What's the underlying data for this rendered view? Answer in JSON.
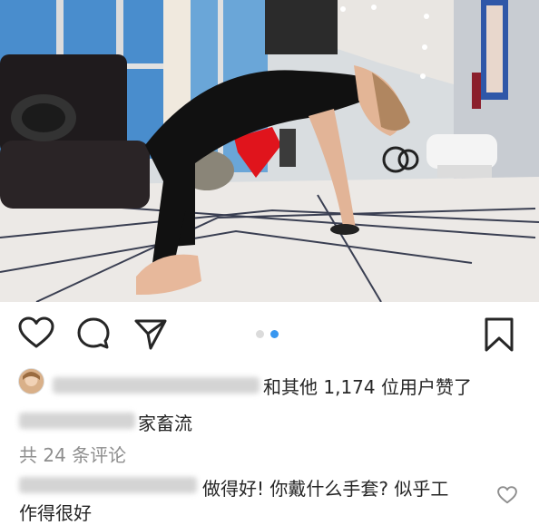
{
  "post": {
    "photo": {
      "alt": "yoga-backbend-photo",
      "carousel_index": 2,
      "carousel_total": 2
    },
    "actions": {
      "like_icon": "heart-outline-icon",
      "comment_icon": "comment-bubble-icon",
      "share_icon": "paper-plane-icon",
      "save_icon": "bookmark-outline-icon"
    },
    "colors": {
      "text": "#262626",
      "muted": "#8e8e8e",
      "dot_active": "#3897f0",
      "dot_inactive": "#dbdbdb"
    },
    "likes": {
      "text": "和其他 1,174 位用户赞了"
    },
    "caption": {
      "text": "家畜流"
    },
    "view_comments": "共 24 条评论",
    "comment": {
      "text_line1": "做得好! 你戴什么手套? 似乎工",
      "text_line2": "作得很好",
      "like_icon": "heart-small-icon"
    }
  }
}
